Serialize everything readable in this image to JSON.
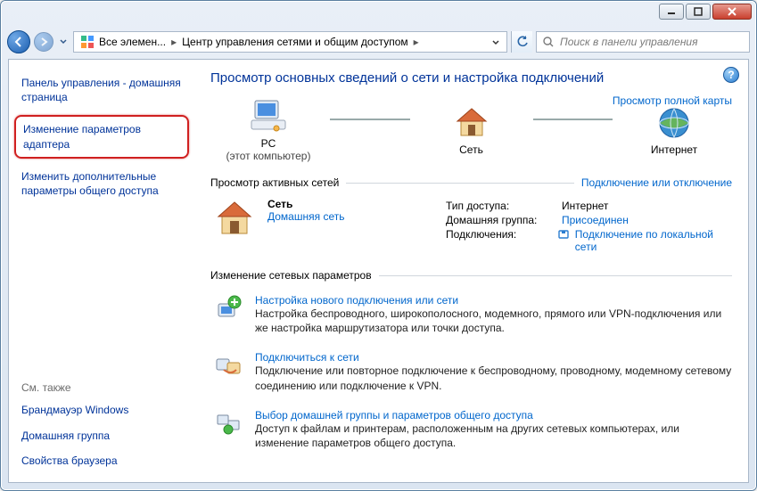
{
  "address": {
    "crumb1": "Все элемен...",
    "crumb2": "Центр управления сетями и общим доступом"
  },
  "search": {
    "placeholder": "Поиск в панели управления"
  },
  "sidebar": {
    "home": "Панель управления - домашняя страница",
    "adapter": "Изменение параметров адаптера",
    "sharing": "Изменить дополнительные параметры общего доступа",
    "seealso_title": "См. также",
    "firewall": "Брандмауэр Windows",
    "homegroup": "Домашняя группа",
    "browser": "Свойства браузера"
  },
  "main": {
    "title": "Просмотр основных сведений о сети и настройка подключений",
    "full_map": "Просмотр полной карты"
  },
  "map": {
    "computer": {
      "name": "PC",
      "caption": "(этот компьютер)"
    },
    "network": {
      "name": "Сеть"
    },
    "internet": {
      "name": "Интернет"
    }
  },
  "sections": {
    "active": {
      "title": "Просмотр активных сетей",
      "action": "Подключение или отключение"
    },
    "change": {
      "title": "Изменение сетевых параметров"
    }
  },
  "networks": [
    {
      "name": "Сеть",
      "category": "Домашняя сеть",
      "access_k": "Тип доступа:",
      "access_v": "Интернет",
      "homegroup_k": "Домашняя группа:",
      "homegroup_v": "Присоединен",
      "conn_k": "Подключения:",
      "conn_v": "Подключение по локальной сети"
    }
  ],
  "tasks": [
    {
      "title": "Настройка нового подключения или сети",
      "desc": "Настройка беспроводного, широкополосного, модемного, прямого или VPN-подключения или же настройка маршрутизатора или точки доступа."
    },
    {
      "title": "Подключиться к сети",
      "desc": "Подключение или повторное подключение к беспроводному, проводному, модемному сетевому соединению или подключение к VPN."
    },
    {
      "title": "Выбор домашней группы и параметров общего доступа",
      "desc": "Доступ к файлам и принтерам, расположенным на других сетевых компьютерах, или изменение параметров общего доступа."
    }
  ]
}
